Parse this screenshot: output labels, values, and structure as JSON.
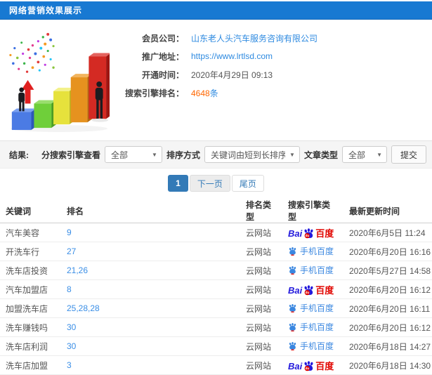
{
  "colors": {
    "topbar_blue": "#1879d2",
    "link_blue": "#2e8ae0",
    "count_orange": "#ff6600",
    "pagination_active": "#337ab7",
    "baidu_blue": "#2319dc",
    "baidu_red": "#e10601",
    "mobile_baidu_blue": "#3a87e0"
  },
  "header": {
    "title": "网络营销效果展示"
  },
  "info": {
    "company_label": "会员公司：",
    "company_value": "山东老人头汽车服务咨询有限公司",
    "url_label": "推广地址：",
    "url_value": "https://www.lrtlsd.com",
    "open_time_label": "开通时间：",
    "open_time_value": "2020年4月29日 09:13",
    "rank_label": "搜索引擎排名：",
    "rank_count": "4648",
    "rank_unit": "条"
  },
  "filters": {
    "section_label": "结果:",
    "engine_filter_label": "分搜索引擎查看",
    "engine_filter_value": "全部",
    "sort_label": "排序方式",
    "sort_value": "关键词由短到长排序",
    "article_type_label": "文章类型",
    "article_type_value": "全部",
    "submit_label": "提交"
  },
  "pagination": {
    "current": "1",
    "next": "下一页",
    "last": "尾页"
  },
  "table": {
    "headers": [
      "关键词",
      "排名",
      "排名类型",
      "搜索引擎类型",
      "最新更新时间"
    ],
    "baidu_logo": {
      "bai": "Bai",
      "du": "du",
      "suffix": "百度"
    },
    "mobile_baidu_label": "手机百度",
    "rank_type_cloud": "云网站",
    "rows": [
      {
        "keyword": "汽车美容",
        "rank": "9",
        "rank_type": "云网站",
        "engine": "baidu",
        "updated": "2020年6月5日 11:24"
      },
      {
        "keyword": "开洗车行",
        "rank": "27",
        "rank_type": "云网站",
        "engine": "mobile-baidu",
        "updated": "2020年6月20日 16:16"
      },
      {
        "keyword": "洗车店投资",
        "rank": "21,26",
        "rank_type": "云网站",
        "engine": "mobile-baidu",
        "updated": "2020年5月27日 14:58"
      },
      {
        "keyword": "汽车加盟店",
        "rank": "8",
        "rank_type": "云网站",
        "engine": "baidu",
        "updated": "2020年6月20日 16:12"
      },
      {
        "keyword": "加盟洗车店",
        "rank": "25,28,28",
        "rank_type": "云网站",
        "engine": "mobile-baidu",
        "updated": "2020年6月20日 16:11"
      },
      {
        "keyword": "洗车赚钱吗",
        "rank": "30",
        "rank_type": "云网站",
        "engine": "mobile-baidu",
        "updated": "2020年6月20日 16:12"
      },
      {
        "keyword": "洗车店利润",
        "rank": "30",
        "rank_type": "云网站",
        "engine": "mobile-baidu",
        "updated": "2020年6月18日 14:27"
      },
      {
        "keyword": "洗车店加盟",
        "rank": "3",
        "rank_type": "云网站",
        "engine": "baidu",
        "updated": "2020年6月18日 14:30"
      }
    ]
  }
}
